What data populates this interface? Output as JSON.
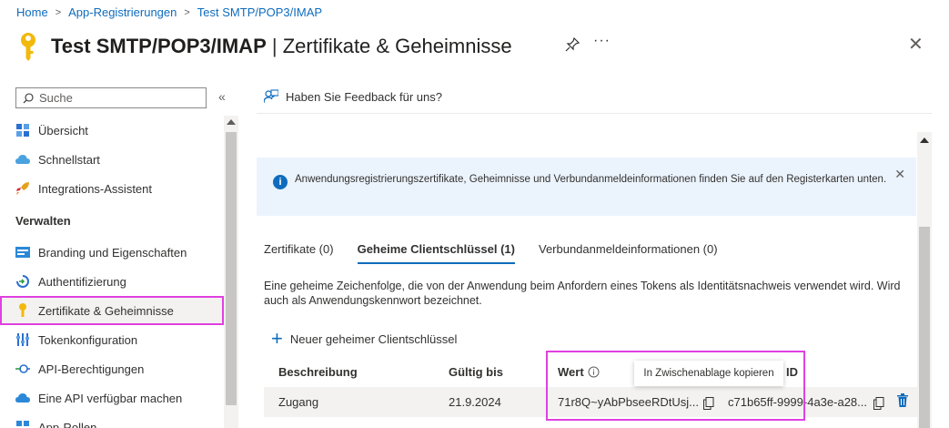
{
  "breadcrumb": [
    "Home",
    "App-Registrierungen",
    "Test SMTP/POP3/IMAP"
  ],
  "title": {
    "app": "Test SMTP/POP3/IMAP",
    "separator": " | ",
    "section": "Zertifikate & Geheimnisse"
  },
  "header_icons": {
    "pin": "pin-icon",
    "more": "···",
    "close": "✕"
  },
  "sidebar": {
    "search_placeholder": "Suche",
    "collapse": "«",
    "items_top": [
      {
        "label": "Übersicht",
        "icon": "overview-grid-icon"
      },
      {
        "label": "Schnellstart",
        "icon": "cloud-icon"
      },
      {
        "label": "Integrations-Assistent",
        "icon": "rocket-icon"
      }
    ],
    "section_label": "Verwalten",
    "items_manage": [
      {
        "label": "Branding und Eigenschaften",
        "icon": "branding-icon"
      },
      {
        "label": "Authentifizierung",
        "icon": "authentication-icon"
      },
      {
        "label": "Zertifikate & Geheimnisse",
        "icon": "key-icon",
        "active": true
      },
      {
        "label": "Tokenkonfiguration",
        "icon": "token-config-icon"
      },
      {
        "label": "API-Berechtigungen",
        "icon": "api-permissions-icon"
      },
      {
        "label": "Eine API verfügbar machen",
        "icon": "cloud-api-icon"
      },
      {
        "label": "App-Rollen",
        "icon": "app-roles-icon"
      }
    ]
  },
  "feedback_label": "Haben Sie Feedback für uns?",
  "infobar_text": "Anwendungsregistrierungszertifikate, Geheimnisse und Verbundanmeldeinformationen finden Sie auf den Registerkarten unten.",
  "tabs": [
    {
      "label": "Zertifikate (0)"
    },
    {
      "label": "Geheime Clientschlüssel (1)",
      "active": true
    },
    {
      "label": "Verbundanmeldeinformationen (0)"
    }
  ],
  "description": "Eine geheime Zeichenfolge, die von der Anwendung beim Anfordern eines Tokens als Identitätsnachweis verwendet wird. Wird auch als Anwendungskennwort bezeichnet.",
  "new_secret_label": "Neuer geheimer Clientschlüssel",
  "table": {
    "headers": {
      "description": "Beschreibung",
      "expires": "Gültig bis",
      "value": "Wert",
      "id": "ID"
    },
    "rows": [
      {
        "description": "Zugang",
        "expires": "21.9.2024",
        "value": "71r8Q~yAbPbseeRDtUsj...",
        "id": "c71b65ff-9999-4a3e-a28..."
      }
    ]
  },
  "tooltip": "In Zwischenablage kopieren",
  "colors": {
    "accent": "#0f6cbd",
    "highlight": "#e040e0",
    "info_bg": "#ebf3fc"
  }
}
